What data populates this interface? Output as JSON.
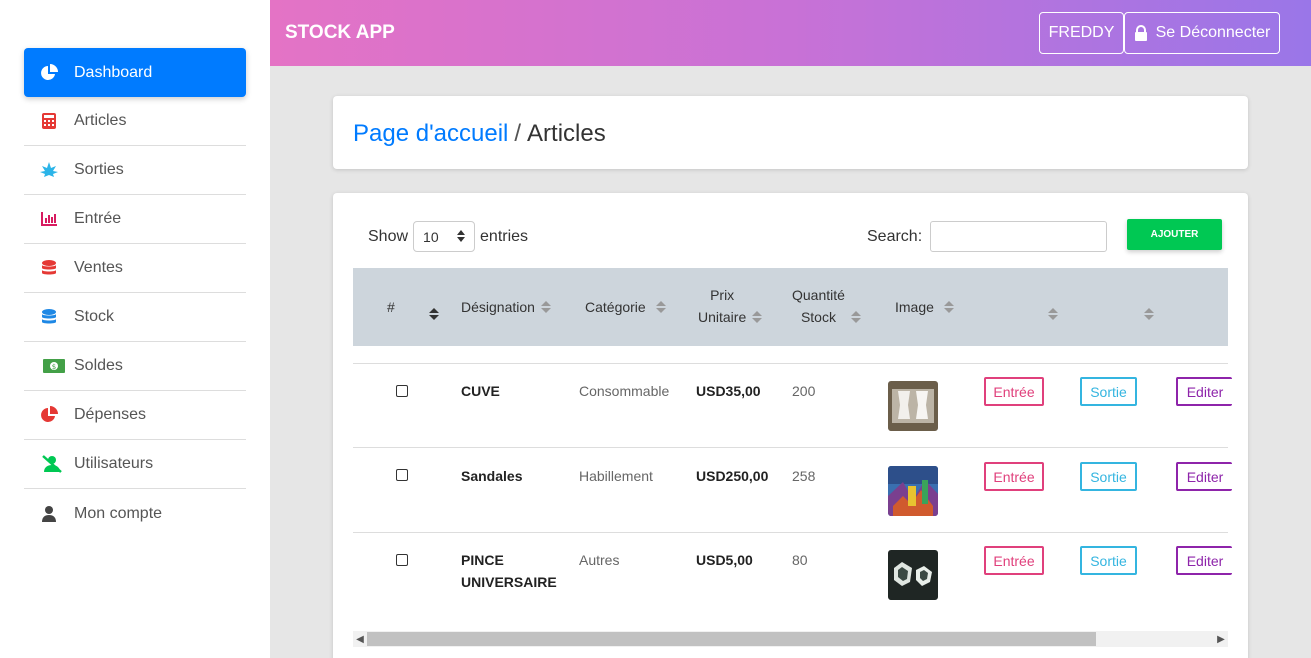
{
  "sidebar": {
    "items": [
      {
        "label": "Dashboard",
        "icon": "pie-chart-icon",
        "active": true
      },
      {
        "label": "Articles",
        "icon": "calculator-icon"
      },
      {
        "label": "Sorties",
        "icon": "leaf-icon"
      },
      {
        "label": "Entrée",
        "icon": "bar-chart-icon"
      },
      {
        "label": "Ventes",
        "icon": "database-icon"
      },
      {
        "label": "Stock",
        "icon": "database-icon"
      },
      {
        "label": "Soldes",
        "icon": "money-bill-icon"
      },
      {
        "label": "Dépenses",
        "icon": "pie-chart-icon"
      },
      {
        "label": "Utilisateurs",
        "icon": "user-slash-icon"
      },
      {
        "label": "Mon compte",
        "icon": "user-icon"
      }
    ]
  },
  "header": {
    "app_title": "STOCK APP",
    "user_label": "FREDDY",
    "logout_label": "Se Déconnecter"
  },
  "breadcrumb": {
    "home": "Page d'accueil",
    "separator": "/",
    "current": "Articles"
  },
  "table_controls": {
    "show_label": "Show",
    "entries_value": "10",
    "entries_label": "entries",
    "search_label": "Search:",
    "add_button": "AJOUTER"
  },
  "table": {
    "columns": {
      "num": "#",
      "designation": "Désignation",
      "categorie": "Catégorie",
      "prix_1": "Prix",
      "prix_2": "Unitaire",
      "quantite_1": "Quantité",
      "quantite_2": "Stock",
      "image": "Image"
    },
    "rows": [
      {
        "designation": "CUVE",
        "designation_2": "",
        "categorie": "Consommable",
        "prix": "USD35,00",
        "quantite": "200"
      },
      {
        "designation": "Sandales",
        "designation_2": "",
        "categorie": "Habillement",
        "prix": "USD250,00",
        "quantite": "258"
      },
      {
        "designation": "PINCE",
        "designation_2": "UNIVERSAIRE",
        "categorie": "Autres",
        "prix": "USD5,00",
        "quantite": "80"
      }
    ],
    "actions": {
      "entree": "Entrée",
      "sortie": "Sortie",
      "editer": "Editer"
    }
  },
  "colors": {
    "accent": "#007bff",
    "success": "#00c853",
    "entree": "#e0407c",
    "sortie": "#34b5e0",
    "editer": "#8e24aa"
  }
}
